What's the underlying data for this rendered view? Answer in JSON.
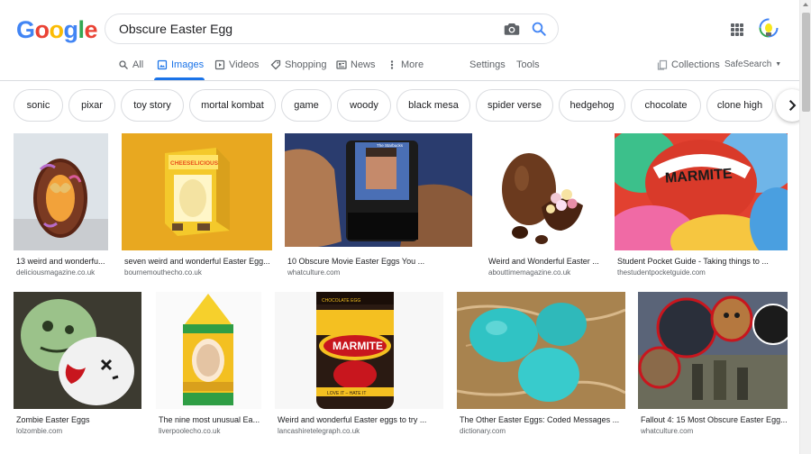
{
  "header": {
    "logo": [
      "G",
      "o",
      "o",
      "g",
      "l",
      "e"
    ],
    "logo_colors": [
      "#4285f4",
      "#ea4335",
      "#fbbc05",
      "#4285f4",
      "#34a853",
      "#ea4335"
    ],
    "search_query": "Obscure Easter Egg"
  },
  "tabs": {
    "all": "All",
    "images": "Images",
    "videos": "Videos",
    "shopping": "Shopping",
    "news": "News",
    "more": "More",
    "settings": "Settings",
    "tools": "Tools",
    "collections": "Collections",
    "safesearch": "SafeSearch"
  },
  "chips": [
    "sonic",
    "pixar",
    "toy story",
    "mortal kombat",
    "game",
    "woody",
    "black mesa",
    "spider verse",
    "hedgehog",
    "chocolate",
    "clone high"
  ],
  "results": [
    {
      "caption": "13 weird and wonderfu...",
      "source": "deliciousmagazine.co.uk"
    },
    {
      "caption": "seven weird and wonderful Easter Egg...",
      "source": "bournemouthecho.co.uk"
    },
    {
      "caption": "10 Obscure Movie Easter Eggs You ...",
      "source": "whatculture.com"
    },
    {
      "caption": "Weird and Wonderful Easter ...",
      "source": "abouttimemagazine.co.uk"
    },
    {
      "caption": "Student Pocket Guide - Taking things to ...",
      "source": "thestudentpocketguide.com"
    },
    {
      "caption": "Zombie Easter Eggs",
      "source": "lolzombie.com"
    },
    {
      "caption": "The nine most unusual Ea...",
      "source": "liverpoolecho.co.uk"
    },
    {
      "caption": "Weird and wonderful Easter eggs to try ...",
      "source": "lancashiretelegraph.co.uk"
    },
    {
      "caption": "The Other Easter Eggs: Coded Messages ...",
      "source": "dictionary.com"
    },
    {
      "caption": "Fallout 4: 15 Most Obscure Easter Egg...",
      "source": "whatculture.com"
    }
  ],
  "image_text": {
    "cheese_box": "CHEESELICIOUS",
    "marmite_1": "MARMITE",
    "marmite_2": "MARMITE",
    "marmite_2_top": "CHOCOLATE EGG",
    "marmite_2_bottom": "LOVE IT – HATE IT",
    "phone_text": "The Starbucks"
  },
  "accent_color": "#1a73e8"
}
